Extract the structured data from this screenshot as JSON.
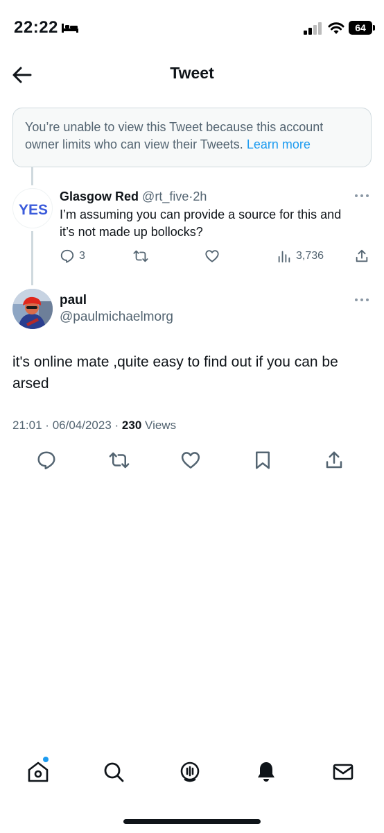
{
  "status_bar": {
    "time": "22:22",
    "battery": "64"
  },
  "header": {
    "title": "Tweet"
  },
  "notice": {
    "text": "You’re unable to view this Tweet because this account owner limits who can view their Tweets.",
    "link": "Learn more"
  },
  "parent_tweet": {
    "avatar_text": "YES",
    "name": "Glasgow Red",
    "handle": "@rt_five",
    "sep": "·",
    "time": "2h",
    "text": "I’m assuming you can provide a source for this and it’s not made up bollocks?",
    "replies": "3",
    "views": "3,736"
  },
  "main_tweet": {
    "name": "paul",
    "handle": "@paulmichaelmorg",
    "text": "it's online mate ,quite easy to find out if you can be arsed",
    "time": "21:01",
    "sep1": "·",
    "date": "06/04/2023",
    "sep2": "·",
    "views_count": "230",
    "views_label": "Views"
  },
  "colors": {
    "accent": "#1d9bf0",
    "muted": "#536471",
    "border": "#cfd9de"
  }
}
